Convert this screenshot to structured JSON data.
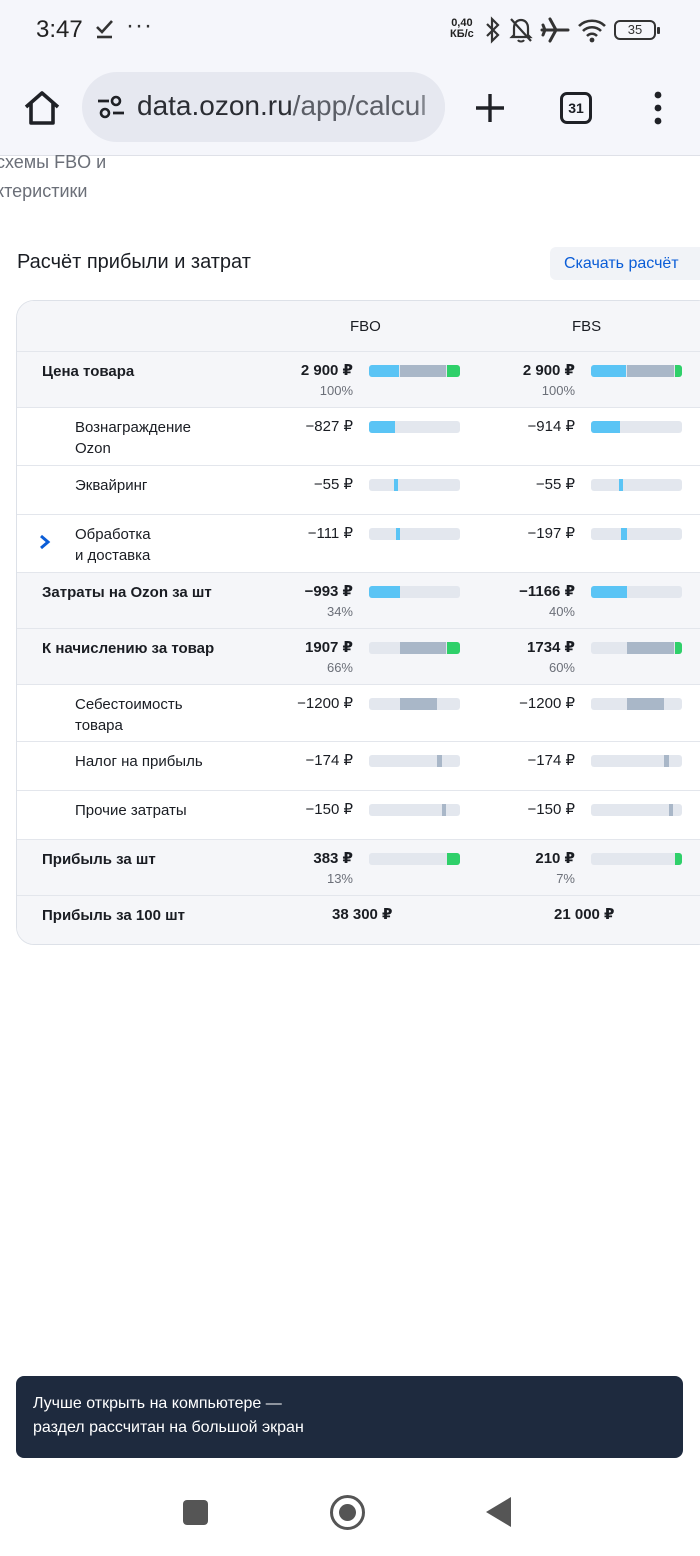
{
  "status_bar": {
    "time": "3:47",
    "net_speed_value": "0,40",
    "net_speed_unit": "КБ/с",
    "battery": "35"
  },
  "browser": {
    "url_host": "data.ozon.ru",
    "url_path": "/app/calcul",
    "tab_count": "31"
  },
  "page": {
    "crumb_line1": "схемы FBO и",
    "crumb_line2": "ктеристики",
    "section_title": "Расчёт прибыли и затрат",
    "download_label": "Скачать расчёт"
  },
  "table": {
    "columns": [
      "FBO",
      "FBS"
    ],
    "rows": [
      {
        "label": "Цена товара",
        "fbo": "2 900 ₽",
        "fbo_pct": "100%",
        "fbs": "2 900 ₽",
        "fbs_pct": "100%"
      },
      {
        "label_l1": "Вознаграждение",
        "label_l2": "Ozon",
        "fbo": "−827 ₽",
        "fbs": "−914 ₽"
      },
      {
        "label": "Эквайринг",
        "fbo": "−55 ₽",
        "fbs": "−55 ₽"
      },
      {
        "label_l1": "Обработка",
        "label_l2": "и доставка",
        "fbo": "−111 ₽",
        "fbs": "−197 ₽"
      },
      {
        "label": "Затраты на Ozon за шт",
        "fbo": "−993 ₽",
        "fbo_pct": "34%",
        "fbs": "−1166 ₽",
        "fbs_pct": "40%"
      },
      {
        "label": "К начислению за товар",
        "fbo": "1907 ₽",
        "fbo_pct": "66%",
        "fbs": "1734 ₽",
        "fbs_pct": "60%"
      },
      {
        "label_l1": "Себестоимость",
        "label_l2": "товара",
        "fbo": "−1200 ₽",
        "fbs": "−1200 ₽"
      },
      {
        "label": "Налог на прибыль",
        "fbo": "−174 ₽",
        "fbs": "−174 ₽"
      },
      {
        "label": "Прочие затраты",
        "fbo": "−150 ₽",
        "fbs": "−150 ₽"
      },
      {
        "label": "Прибыль за шт",
        "fbo": "383 ₽",
        "fbo_pct": "13%",
        "fbs": "210 ₽",
        "fbs_pct": "7%"
      },
      {
        "label": "Прибыль за 100 шт",
        "fbo": "38 300 ₽",
        "fbs": "21 000 ₽"
      }
    ]
  },
  "toast": {
    "line1": "Лучше открыть на компьютере —",
    "line2": "раздел рассчитан на большой экран"
  },
  "colors": {
    "commission_blue": "#5ac4f5",
    "cost_gray": "#a9b7c8",
    "profit_green": "#2fd06a",
    "track": "#e3e7ee",
    "accent_link": "#0b5dd7",
    "toast_bg": "#1e2a3e"
  }
}
